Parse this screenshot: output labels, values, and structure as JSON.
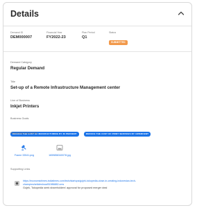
{
  "header": {
    "title": "Details"
  },
  "meta": {
    "demand_id_label": "Demand ID",
    "demand_id": "DEM000007",
    "fiscal_year_label": "Financial Year",
    "fiscal_year": "FY2022-23",
    "plan_period_label": "Plan Period",
    "plan_period": "Q1",
    "status_label": "Status",
    "status": "SUBMITTED"
  },
  "fields": {
    "category_label": "Demand Category",
    "category": "Regular Demand",
    "title_label": "Title",
    "title": "Set-up of a Remote Infrastructure Management center",
    "lob_label": "Line of Business",
    "lob": "Inkjet Printers",
    "goals_label": "Business Goals",
    "goals": [
      "REDUCE THE COST OF MANUFACTURING BY 30 PERCENT",
      "REDUCE THE COST OF PRINT SERVICES BY 10PERCENT"
    ]
  },
  "documents": {
    "label": "Supporting Documents",
    "items": [
      {
        "name": "Frame 33541.png",
        "icon": "image-file-icon"
      },
      {
        "name": "1659858340078.jpg",
        "icon": "image-file-icon"
      }
    ]
  },
  "links": {
    "label": "Supporting Links",
    "items": [
      {
        "url": "https://economictimes.indiatimes.com/tech/startups/gojek-tokopedia-close-in-creating-indonesian-tech-champion/articleshow/81986882.cms",
        "caption": "Gojek, Tokopedia seek shareholders' approval for proposed merger deal"
      }
    ]
  },
  "colors": {
    "status_badge": "#f2994a",
    "goal_tag": "#1a73e8",
    "link": "#1a73e8"
  }
}
